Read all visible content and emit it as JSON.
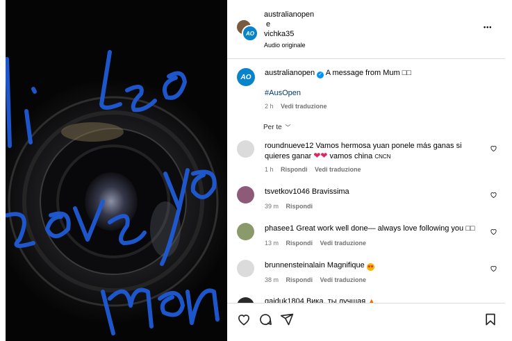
{
  "header": {
    "user1": "australianopen",
    "joiner": "e",
    "user2": "vichka35",
    "audio": "Audio originale",
    "more_label": "•••"
  },
  "caption": {
    "username": "australianopen",
    "text": "A message from Mum □□",
    "hashtag": "#AusOpen",
    "time": "2 h",
    "translate": "Vedi traduzione"
  },
  "filter": {
    "label": "Per te"
  },
  "comments": [
    {
      "user": "roundnueve12",
      "text1": "Vamos hermosa yuan ponele más ganas si",
      "text2": "quieres ganar",
      "tail": "vamos china",
      "tail_small": "CNCN",
      "time": "1 h",
      "reply": "Rispondi",
      "translate": "Vedi traduzione"
    },
    {
      "user": "tsvetkov1046",
      "text1": "Bravissima",
      "time": "39 m",
      "reply": "Rispondi"
    },
    {
      "user": "phasee1",
      "text1": "Great work well done— always love following you □□",
      "time": "13 m",
      "reply": "Rispondi",
      "translate": "Vedi traduzione"
    },
    {
      "user": "brunnensteinalain",
      "text1": "Magnifique",
      "time": "38 m",
      "reply": "Rispondi",
      "translate": "Vedi traduzione"
    },
    {
      "user": "gaiduk1804",
      "text1": "Вика, ты лучшая"
    }
  ],
  "media": {
    "handwriting": [
      "Hi Leo",
      "Love you",
      "Mom"
    ]
  },
  "colors": {
    "accent_blue": "#0a84c9",
    "ink_blue": "#1f5bd6",
    "heart_red": "#e0245e"
  }
}
